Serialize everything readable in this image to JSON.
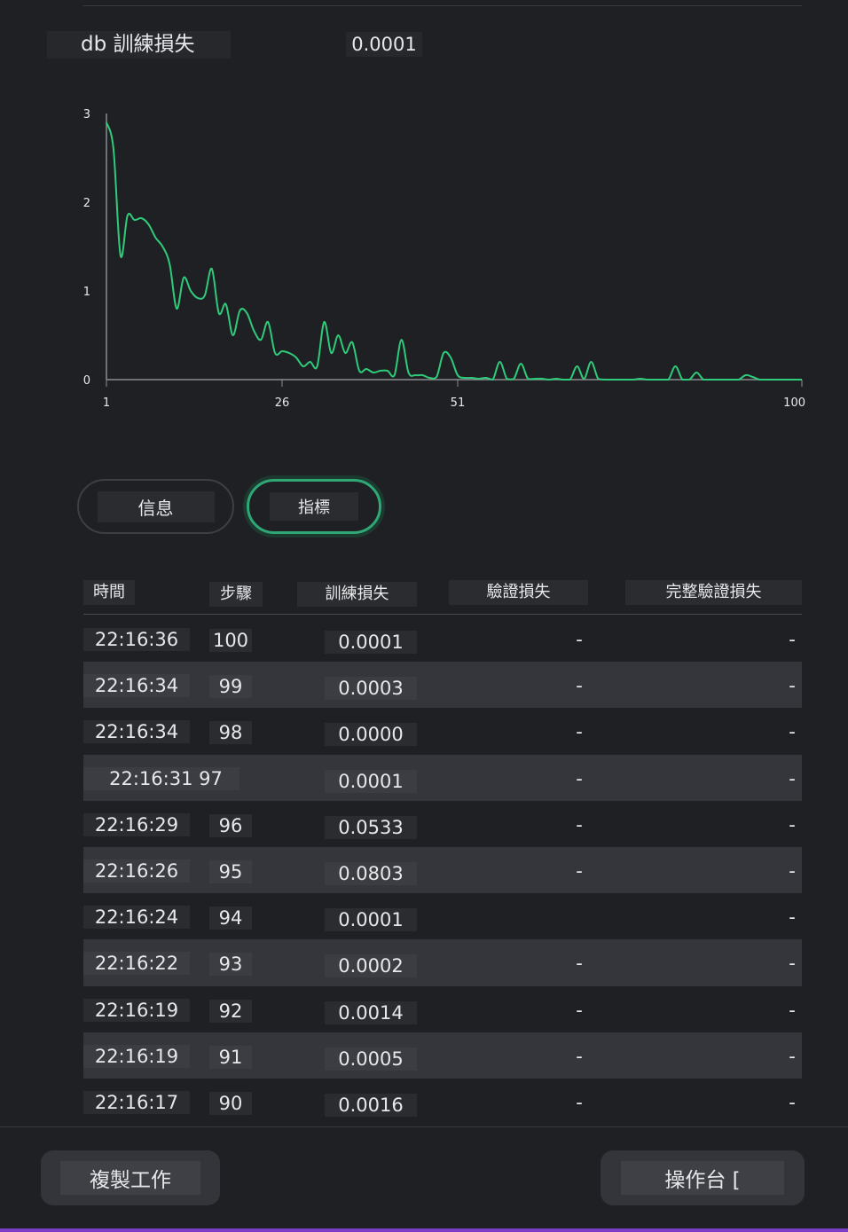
{
  "metric": {
    "name": "db 訓練損失",
    "value": "0.0001"
  },
  "chart_data": {
    "type": "line",
    "xlim": [
      1,
      100
    ],
    "ylim": [
      0,
      3
    ],
    "x_ticks": [
      "1",
      "26",
      "51",
      "100"
    ],
    "y_ticks": [
      "0",
      "1",
      "2",
      "3"
    ],
    "color": "#2ecc7a",
    "series": [
      {
        "values": [
          2.9,
          2.6,
          1.4,
          1.85,
          1.8,
          1.82,
          1.75,
          1.6,
          1.5,
          1.3,
          0.8,
          1.15,
          1.0,
          0.92,
          0.95,
          1.25,
          0.75,
          0.85,
          0.5,
          0.78,
          0.75,
          0.55,
          0.45,
          0.65,
          0.3,
          0.32,
          0.3,
          0.25,
          0.15,
          0.2,
          0.15,
          0.65,
          0.3,
          0.5,
          0.3,
          0.42,
          0.1,
          0.12,
          0.08,
          0.1,
          0.1,
          0.05,
          0.45,
          0.08,
          0.05,
          0.05,
          0.02,
          0.03,
          0.3,
          0.25,
          0.05,
          0.02,
          0.02,
          0.01,
          0.02,
          0.0,
          0.2,
          0.01,
          0.01,
          0.18,
          0.01,
          0.01,
          0.01,
          0.0,
          0.01,
          0.0,
          0.0,
          0.15,
          0.01,
          0.2,
          0.01,
          0.0,
          0.0,
          0.0,
          0.0,
          0.0,
          0.01,
          0.0,
          0.0,
          0.0,
          0.0,
          0.15,
          0.0,
          0.0,
          0.08,
          0.0,
          0.0,
          0.0,
          0.0,
          0.0,
          0.0,
          0.05,
          0.03,
          0.0,
          0.0,
          0.0,
          0.0,
          0.0,
          0.0,
          0.0
        ]
      }
    ]
  },
  "tabs": [
    {
      "label": "信息"
    },
    {
      "label": "指標"
    }
  ],
  "table": {
    "headers": {
      "time": "時間",
      "step": "步驟",
      "train_loss": "訓練損失",
      "val_loss": "驗證損失",
      "full_val_loss": "完整驗證損失"
    },
    "rows": [
      {
        "time": "22:16:36",
        "step": "100",
        "train_loss": "0.0001",
        "val_loss": "-",
        "full_val_loss": "-"
      },
      {
        "time": "22:16:34",
        "step": "99",
        "train_loss": "0.0003",
        "val_loss": "-",
        "full_val_loss": "-"
      },
      {
        "time": "22:16:34",
        "step": "98",
        "train_loss": "0.0000",
        "val_loss": "-",
        "full_val_loss": "-"
      },
      {
        "time": "22:16:31 97",
        "step": "",
        "train_loss": "0.0001",
        "val_loss": "-",
        "full_val_loss": "-"
      },
      {
        "time": "22:16:29",
        "step": "96",
        "train_loss": "0.0533",
        "val_loss": "-",
        "full_val_loss": "-"
      },
      {
        "time": "22:16:26",
        "step": "95",
        "train_loss": "0.0803",
        "val_loss": "-",
        "full_val_loss": "-"
      },
      {
        "time": "22:16:24",
        "step": "94",
        "train_loss": "0.0001",
        "val_loss": "",
        "full_val_loss": "-"
      },
      {
        "time": "22:16:22",
        "step": "93",
        "train_loss": "0.0002",
        "val_loss": "-",
        "full_val_loss": "-"
      },
      {
        "time": "22:16:19",
        "step": "92",
        "train_loss": "0.0014",
        "val_loss": "-",
        "full_val_loss": "-"
      },
      {
        "time": "22:16:19",
        "step": "91",
        "train_loss": "0.0005",
        "val_loss": "-",
        "full_val_loss": "-"
      },
      {
        "time": "22:16:17",
        "step": "90",
        "train_loss": "0.0016",
        "val_loss": "-",
        "full_val_loss": "-"
      }
    ]
  },
  "footer": {
    "copy_job_label": "複製工作",
    "console_label": "操作台 ["
  }
}
